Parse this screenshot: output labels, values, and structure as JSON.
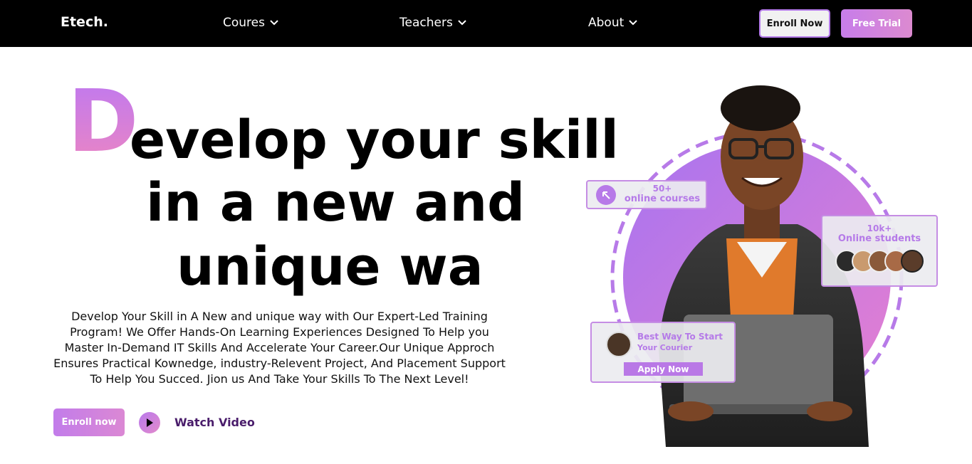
{
  "nav": {
    "logo": "Etech.",
    "items": [
      {
        "label": "Coures"
      },
      {
        "label": "Teachers"
      },
      {
        "label": "About"
      }
    ],
    "enroll_label": "Enroll Now",
    "trial_label": "Free Trial"
  },
  "hero": {
    "big_letter": "D",
    "line1": "evelop your skill",
    "line2": "in a new and",
    "line3": "unique wa",
    "description": "Develop Your Skill in A New and unique way with Our Expert-Led Training Program! We Offer Hands-On Learning Experiences Designed To Help you Master In-Demand IT Skills And Accelerate Your Career.Our Unique Approch Ensures Practical Kownedge, industry-Relevent Project, And Placement Support To Help You Succed. Jion us And Take Your Skills To The Next Level!",
    "enroll_label": "Enroll now",
    "watch_label": "Watch Video"
  },
  "cards": {
    "courses": {
      "number": "50+",
      "label": "online courses"
    },
    "students": {
      "number": "10k+",
      "label": "Online students"
    },
    "start": {
      "title": "Best Way To Start",
      "subtitle": "Your Courier",
      "button": "Apply Now"
    }
  },
  "colors": {
    "accent": "#c27cea",
    "accent2": "#e38acb",
    "navbar": "#000000"
  }
}
